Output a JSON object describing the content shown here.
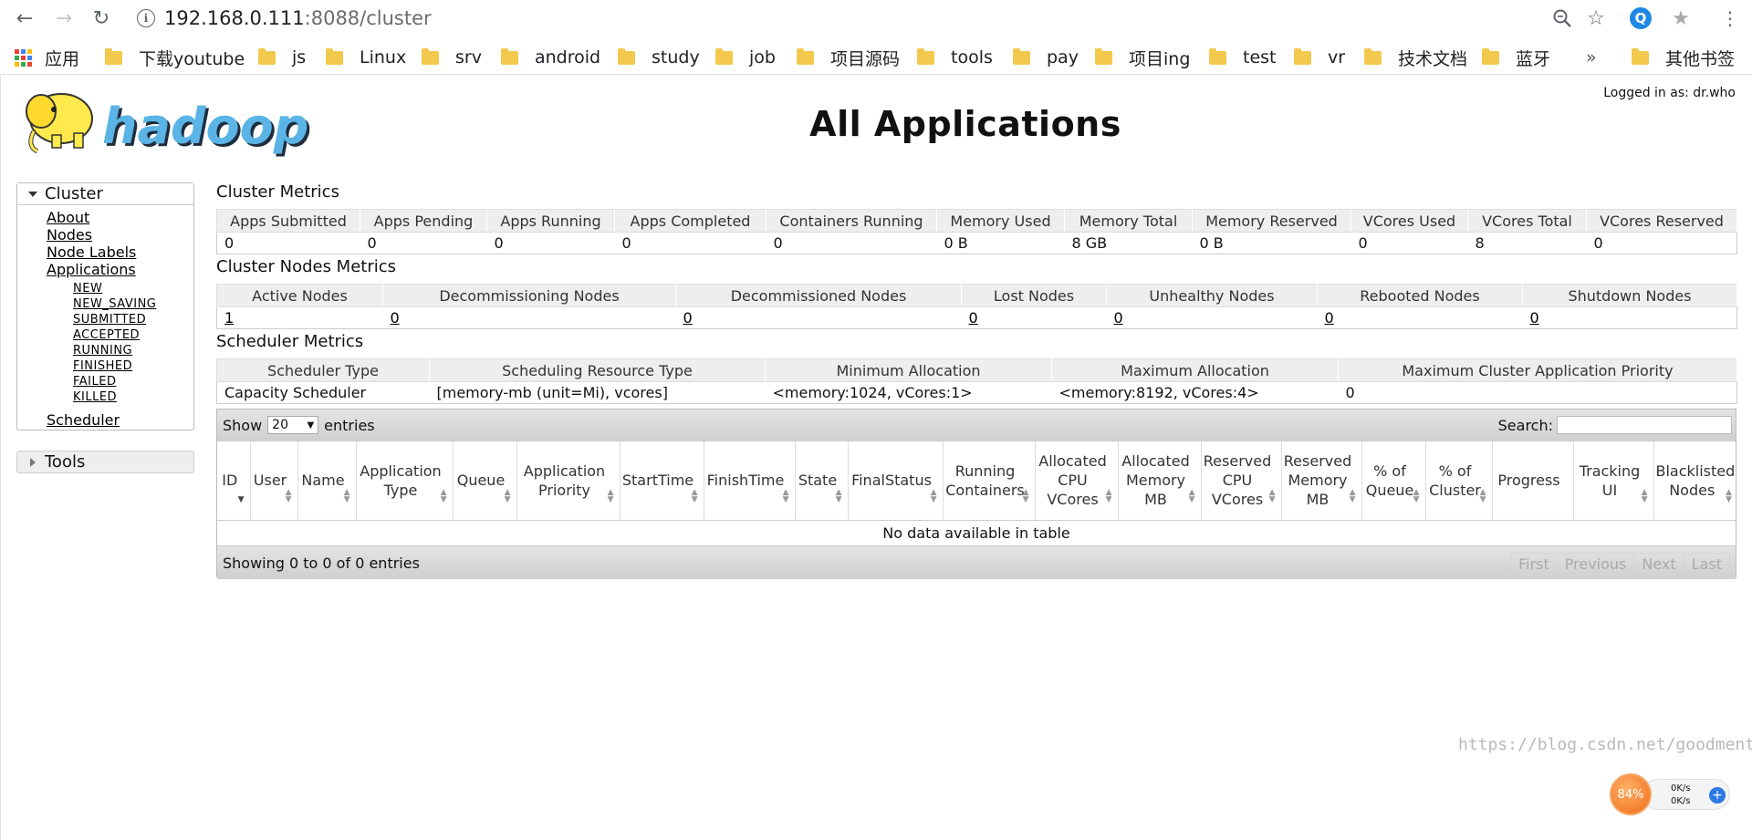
{
  "browser": {
    "url_host": "192.168.0.111",
    "url_path": ":8088/cluster",
    "bookmarks": [
      {
        "label": "应用",
        "type": "apps"
      },
      {
        "label": "下载youtube",
        "type": "folder"
      },
      {
        "label": "js",
        "type": "folder"
      },
      {
        "label": "Linux",
        "type": "folder"
      },
      {
        "label": "srv",
        "type": "folder"
      },
      {
        "label": "android",
        "type": "folder"
      },
      {
        "label": "study",
        "type": "folder"
      },
      {
        "label": "job",
        "type": "folder"
      },
      {
        "label": "项目源码",
        "type": "folder"
      },
      {
        "label": "tools",
        "type": "folder"
      },
      {
        "label": "pay",
        "type": "folder"
      },
      {
        "label": "项目ing",
        "type": "folder"
      },
      {
        "label": "test",
        "type": "folder"
      },
      {
        "label": "vr",
        "type": "folder"
      },
      {
        "label": "技术文档",
        "type": "folder"
      },
      {
        "label": "蓝牙",
        "type": "folder"
      }
    ],
    "overflow": "»",
    "other_bookmarks": "其他书签"
  },
  "header": {
    "logo_text": "hadoop",
    "title": "All Applications",
    "logged_in": "Logged in as: dr.who"
  },
  "nav": {
    "cluster_label": "Cluster",
    "links": [
      "About",
      "Nodes",
      "Node Labels",
      "Applications"
    ],
    "states": [
      "NEW",
      "NEW_SAVING",
      "SUBMITTED",
      "ACCEPTED",
      "RUNNING",
      "FINISHED",
      "FAILED",
      "KILLED"
    ],
    "scheduler": "Scheduler",
    "tools_label": "Tools"
  },
  "cluster_metrics": {
    "title": "Cluster Metrics",
    "headers": [
      "Apps Submitted",
      "Apps Pending",
      "Apps Running",
      "Apps Completed",
      "Containers Running",
      "Memory Used",
      "Memory Total",
      "Memory Reserved",
      "VCores Used",
      "VCores Total",
      "VCores Reserved"
    ],
    "values": [
      "0",
      "0",
      "0",
      "0",
      "0",
      "0 B",
      "8 GB",
      "0 B",
      "0",
      "8",
      "0"
    ]
  },
  "node_metrics": {
    "title": "Cluster Nodes Metrics",
    "headers": [
      "Active Nodes",
      "Decommissioning Nodes",
      "Decommissioned Nodes",
      "Lost Nodes",
      "Unhealthy Nodes",
      "Rebooted Nodes",
      "Shutdown Nodes"
    ],
    "values": [
      "1",
      "0",
      "0",
      "0",
      "0",
      "0",
      "0"
    ]
  },
  "scheduler_metrics": {
    "title": "Scheduler Metrics",
    "headers": [
      "Scheduler Type",
      "Scheduling Resource Type",
      "Minimum Allocation",
      "Maximum Allocation",
      "Maximum Cluster Application Priority"
    ],
    "values": [
      "Capacity Scheduler",
      "[memory-mb (unit=Mi), vcores]",
      "<memory:1024, vCores:1>",
      "<memory:8192, vCores:4>",
      "0"
    ]
  },
  "apps_table": {
    "show_label": "Show",
    "entries_value": "20",
    "entries_label": "entries",
    "search_label": "Search:",
    "columns": [
      "ID",
      "User",
      "Name",
      "Application Type",
      "Queue",
      "Application Priority",
      "StartTime",
      "FinishTime",
      "State",
      "FinalStatus",
      "Running Containers",
      "Allocated CPU VCores",
      "Allocated Memory MB",
      "Reserved CPU VCores",
      "Reserved Memory MB",
      "% of Queue",
      "% of Cluster",
      "Progress",
      "Tracking UI",
      "Blacklisted Nodes"
    ],
    "empty_text": "No data available in table",
    "info_text": "Showing 0 to 0 of 0 entries",
    "pager": [
      "First",
      "Previous",
      "Next",
      "Last"
    ]
  },
  "overlay": {
    "watermark": "https://blog.csdn.net/goodmentc",
    "net_percent": "84%",
    "net_up": "0K/s",
    "net_down": "0K/s"
  }
}
